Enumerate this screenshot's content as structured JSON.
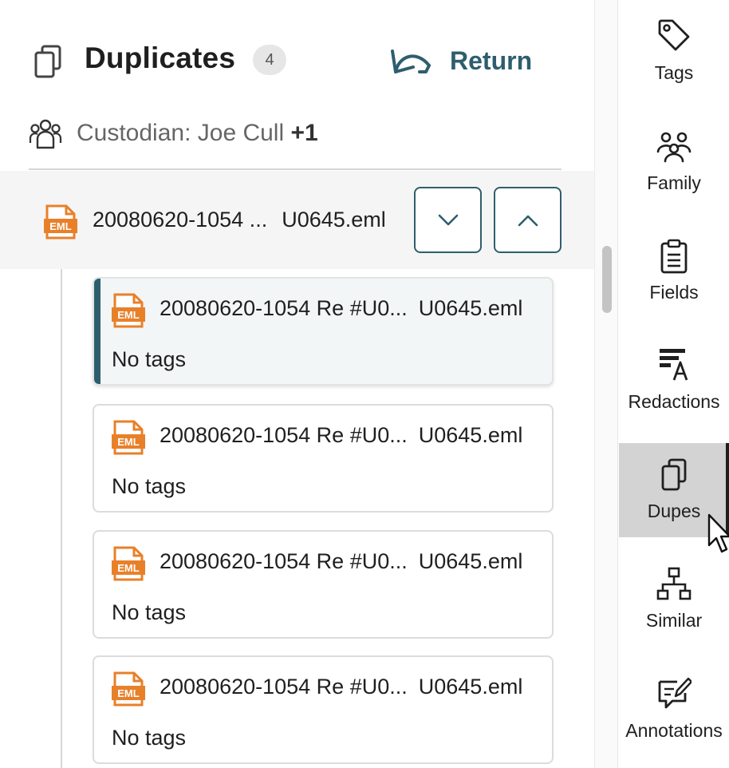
{
  "header": {
    "title": "Duplicates",
    "count": "4",
    "return_label": "Return"
  },
  "custodian": {
    "label": "Custodian: Joe Cull",
    "extra": "+1"
  },
  "current_doc": {
    "name_start": "20080620-1054 ...",
    "name_end": "U0645.eml"
  },
  "duplicates": [
    {
      "name_start": "20080620-1054 Re #U0...",
      "name_end": "U0645.eml",
      "tags": "No tags"
    },
    {
      "name_start": "20080620-1054 Re #U0...",
      "name_end": "U0645.eml",
      "tags": "No tags"
    },
    {
      "name_start": "20080620-1054 Re #U0...",
      "name_end": "U0645.eml",
      "tags": "No tags"
    },
    {
      "name_start": "20080620-1054 Re #U0...",
      "name_end": "U0645.eml",
      "tags": "No tags"
    }
  ],
  "rail": {
    "items": [
      {
        "label": "Tags",
        "icon": "tag-icon"
      },
      {
        "label": "Family",
        "icon": "family-icon"
      },
      {
        "label": "Fields",
        "icon": "clipboard-icon"
      },
      {
        "label": "Redactions",
        "icon": "redaction-icon"
      },
      {
        "label": "Dupes",
        "icon": "duplicate-icon"
      },
      {
        "label": "Similar",
        "icon": "hierarchy-icon"
      },
      {
        "label": "Annotations",
        "icon": "annotation-icon"
      }
    ],
    "active": "Dupes"
  },
  "colors": {
    "accent": "#2e5e6e",
    "eml_orange": "#e8802a",
    "active_rail_bg": "#d3d3d3"
  }
}
